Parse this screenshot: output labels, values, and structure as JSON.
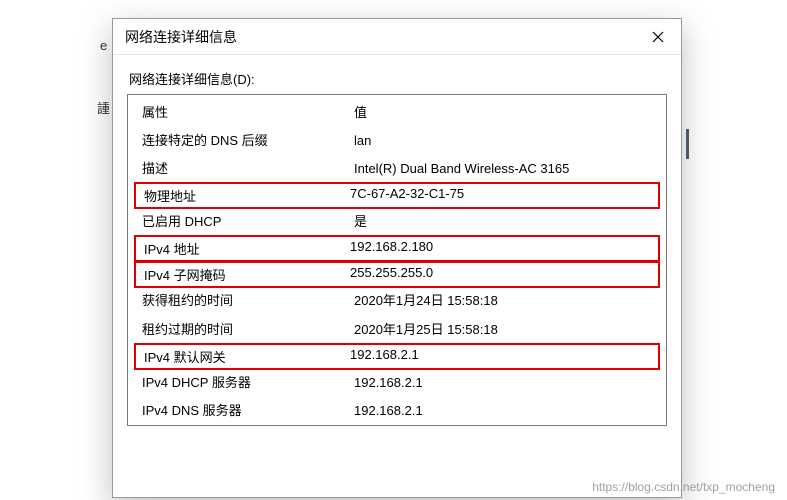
{
  "backdrop": {
    "letter1": "e",
    "letter2": "諥"
  },
  "dialog": {
    "title": "网络连接详细信息",
    "section_label": "网络连接详细信息(D):",
    "headers": {
      "property": "属性",
      "value": "值"
    },
    "rows": [
      {
        "prop": "连接特定的 DNS 后缀",
        "val": "lan",
        "hl": false
      },
      {
        "prop": "描述",
        "val": "Intel(R) Dual Band Wireless-AC 3165",
        "hl": false
      },
      {
        "prop": "物理地址",
        "val": "7C-67-A2-32-C1-75",
        "hl": true
      },
      {
        "prop": "已启用 DHCP",
        "val": "是",
        "hl": false
      },
      {
        "prop": "IPv4 地址",
        "val": "192.168.2.180",
        "hl": true
      },
      {
        "prop": "IPv4 子网掩码",
        "val": "255.255.255.0",
        "hl": true
      },
      {
        "prop": "获得租约的时间",
        "val": "2020年1月24日 15:58:18",
        "hl": false
      },
      {
        "prop": "租约过期的时间",
        "val": "2020年1月25日 15:58:18",
        "hl": false
      },
      {
        "prop": "IPv4 默认网关",
        "val": "192.168.2.1",
        "hl": true
      },
      {
        "prop": "IPv4 DHCP 服务器",
        "val": "192.168.2.1",
        "hl": false
      },
      {
        "prop": "IPv4 DNS 服务器",
        "val": "192.168.2.1",
        "hl": false
      }
    ]
  },
  "watermark": "https://blog.csdn.net/txp_mocheng"
}
